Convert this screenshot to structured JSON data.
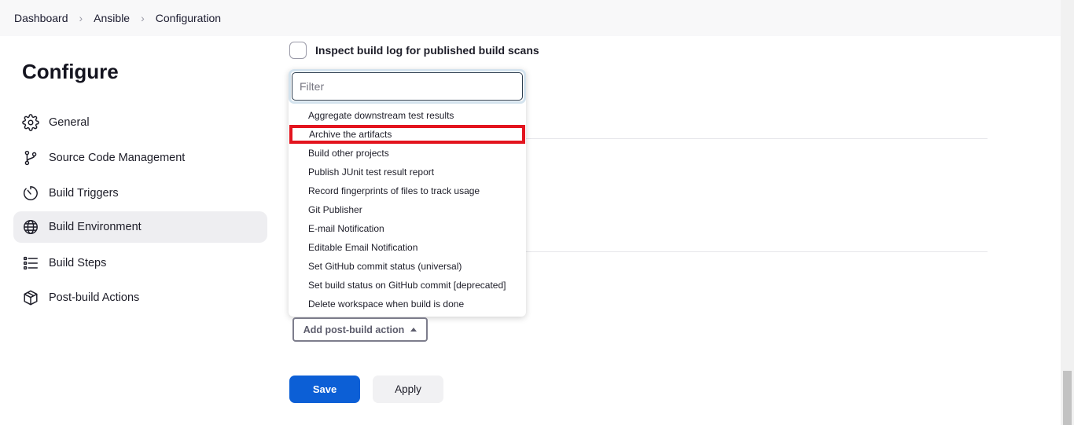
{
  "breadcrumb": {
    "items": [
      "Dashboard",
      "Ansible",
      "Configuration"
    ],
    "separator": "›"
  },
  "sidebar": {
    "title": "Configure",
    "items": [
      {
        "label": "General",
        "icon": "gear-icon"
      },
      {
        "label": "Source Code Management",
        "icon": "branch-icon"
      },
      {
        "label": "Build Triggers",
        "icon": "clock-icon"
      },
      {
        "label": "Build Environment",
        "icon": "globe-icon",
        "active": true
      },
      {
        "label": "Build Steps",
        "icon": "list-icon"
      },
      {
        "label": "Post-build Actions",
        "icon": "package-icon"
      }
    ]
  },
  "main": {
    "checkbox_label": "Inspect build log for published build scans",
    "filter_placeholder": "Filter",
    "dropdown_items": [
      "Aggregate downstream test results",
      "Archive the artifacts",
      "Build other projects",
      "Publish JUnit test result report",
      "Record fingerprints of files to track usage",
      "Git Publisher",
      "E-mail Notification",
      "Editable Email Notification",
      "Set GitHub commit status (universal)",
      "Set build status on GitHub commit [deprecated]",
      "Delete workspace when build is done"
    ],
    "highlighted_item": "Archive the artifacts",
    "add_button_label": "Add post-build action",
    "save_label": "Save",
    "apply_label": "Apply"
  },
  "colors": {
    "primary": "#0c5fd6",
    "highlight_border": "#e3141e",
    "active_sidebar_bg": "#eeeef1"
  }
}
